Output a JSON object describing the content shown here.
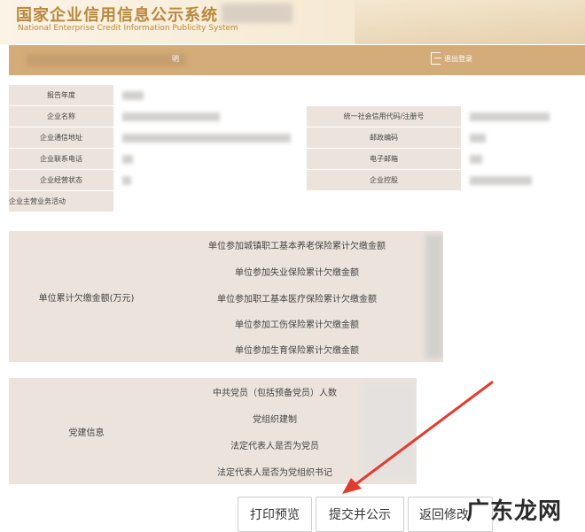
{
  "header": {
    "title_cn": "国家企业信用信息公示系统",
    "title_en": "National Enterprise Credit Information Publicity System"
  },
  "topbar": {
    "user_suffix": "明",
    "logout_label": "退出登录",
    "logout_icon": "logout-icon"
  },
  "info_table": {
    "rows": [
      {
        "label": "报告年度"
      },
      {
        "label": "企业名称",
        "label2": "统一社会信用代码/注册号"
      },
      {
        "label": "企业通信地址",
        "label2": "邮政编码"
      },
      {
        "label": "企业联系电话",
        "label2": "电子邮箱"
      },
      {
        "label": "企业经营状态",
        "label2": "企业控股"
      },
      {
        "label": "企业主营业务活动"
      }
    ]
  },
  "arrears": {
    "label": "单位累计欠缴金额(万元)",
    "items": [
      "单位参加城镇职工基本养老保险累计欠缴金额",
      "单位参加失业保险累计欠缴金额",
      "单位参加职工基本医疗保险累计欠缴金额",
      "单位参加工伤保险累计欠缴金额",
      "单位参加生育保险累计欠缴金额"
    ]
  },
  "party": {
    "label": "党建信息",
    "items": [
      "中共党员（包括预备党员）人数",
      "党组织建制",
      "法定代表人是否为党员",
      "法定代表人是否为党组织书记"
    ]
  },
  "buttons": {
    "print_preview": "打印预览",
    "submit_publish": "提交并公示",
    "return_edit": "返回修改"
  },
  "watermark": "广东龙网",
  "colors": {
    "brand_gold": "#b8893d",
    "bar": "#d4ac79",
    "label_bg": "#ebe3dc",
    "arrow": "#e23b2e"
  }
}
